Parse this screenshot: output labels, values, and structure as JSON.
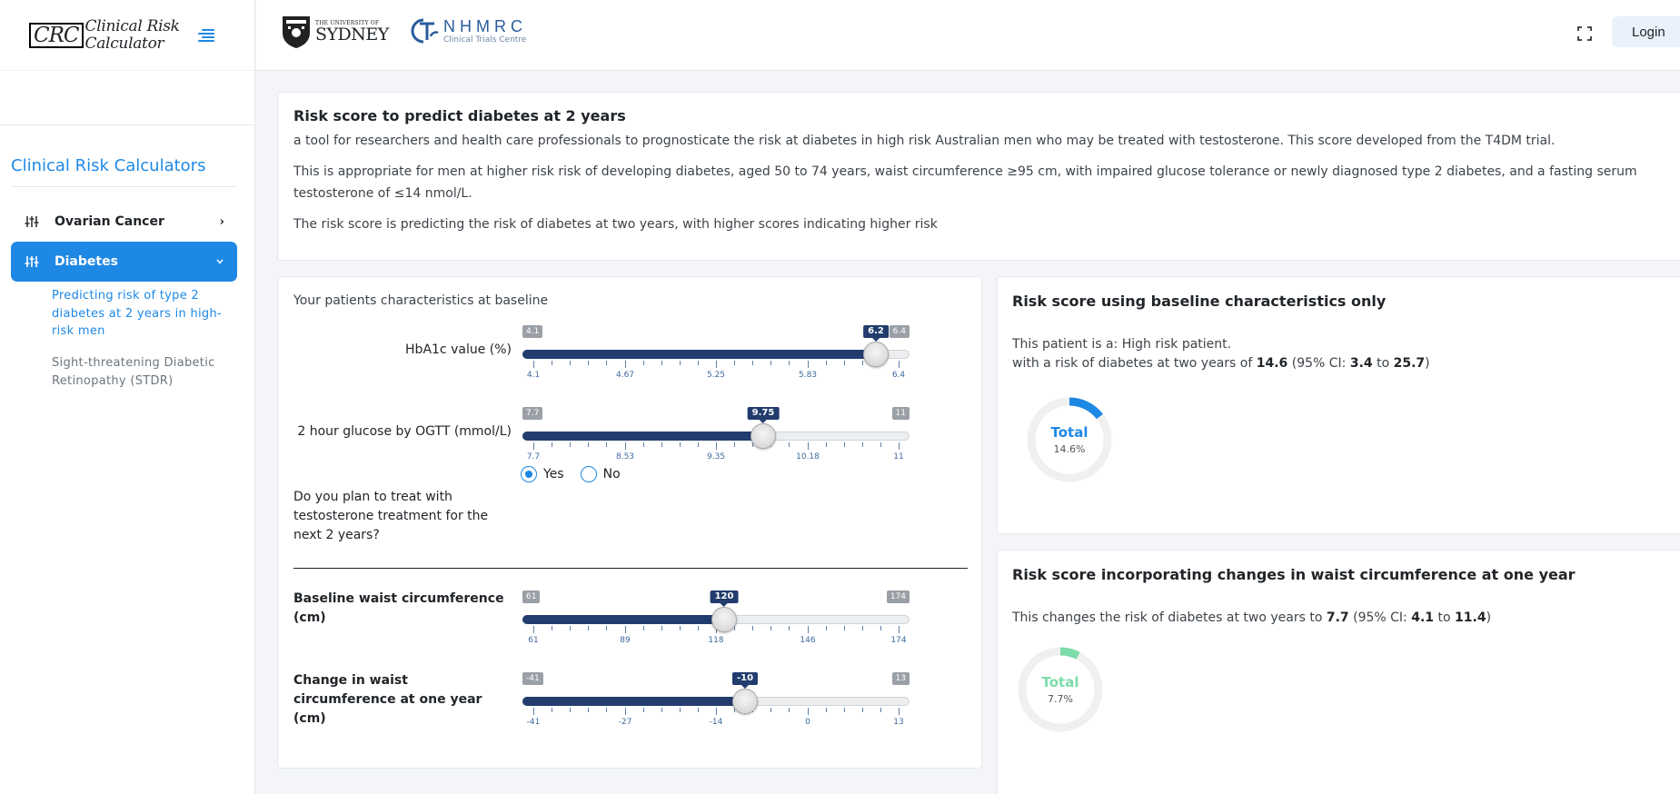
{
  "brand": {
    "crc": "CRC",
    "line1": "Clinical Risk",
    "line2": "Calculator"
  },
  "sidebar": {
    "title": "Clinical Risk Calculators",
    "items": [
      {
        "label": "Ovarian Cancer"
      },
      {
        "label": "Diabetes"
      }
    ],
    "sublinks": [
      {
        "label": "Predicting risk of type 2 diabetes at 2 years in high-risk men"
      },
      {
        "label": "Sight-threatening Diabetic Retinopathy (STDR)"
      }
    ]
  },
  "topbar": {
    "sydney_small": "THE UNIVERSITY OF",
    "sydney_big": "SYDNEY",
    "nhmrc_big": "NHMRC",
    "nhmrc_small": "Clinical Trials Centre",
    "login_label": "Login"
  },
  "info": {
    "title": "Risk score to predict diabetes at 2 years",
    "p1": "a tool for researchers and health care professionals to prognosticate the risk at diabetes in high risk Australian men who may be treated with testosterone. This score developed from the T4DM trial.",
    "p2": "This is appropriate for men at higher risk risk of developing diabetes, aged 50 to 74 years, waist circumference ≥95 cm, with impaired glucose tolerance or newly diagnosed type 2 diabetes, and a fasting serum testosterone of ≤14 nmol/L.",
    "p3": "The risk score is predicting the risk of diabetes at two years, with higher scores indicating higher risk"
  },
  "inputs": {
    "heading": "Your patients characteristics at baseline",
    "hba1c": {
      "label": "HbA1c value (%)",
      "min": 4.1,
      "max": 6.4,
      "value": 6.2,
      "min_label": "4.1",
      "max_label": "6.4",
      "value_label": "6.2",
      "ticks": [
        "4.1",
        "4.67",
        "5.25",
        "5.83",
        "6.4"
      ]
    },
    "glucose": {
      "label": "2 hour glucose by OGTT (mmol/L)",
      "min": 7.7,
      "max": 11,
      "value": 9.75,
      "min_label": "7.7",
      "max_label": "11",
      "value_label": "9.75",
      "ticks": [
        "7.7",
        "8.53",
        "9.35",
        "10.18",
        "11"
      ]
    },
    "question": "Do you plan to treat with testosterone treatment for the next 2 years?",
    "yes_label": "Yes",
    "no_label": "No",
    "selected": "yes",
    "waist": {
      "label": "Baseline waist circumference (cm)",
      "min": 61,
      "max": 174,
      "value": 120,
      "min_label": "61",
      "max_label": "174",
      "value_label": "120",
      "ticks": [
        "61",
        "89",
        "118",
        "146",
        "174"
      ]
    },
    "waist_change": {
      "label": "Change in waist circumference at one year (cm)",
      "min": -41,
      "max": 13,
      "value": -10,
      "min_label": "-41",
      "max_label": "13",
      "value_label": "-10",
      "ticks": [
        "-41",
        "-27",
        "-14",
        "0",
        "13"
      ]
    }
  },
  "result1": {
    "title": "Risk score using baseline characteristics only",
    "line1": "This patient is a: High risk patient.",
    "line2_pre": "with a risk of diabetes at two years of ",
    "risk": "14.6",
    "ci_pre": " (95% CI: ",
    "ci_low": "3.4",
    "ci_mid": " to ",
    "ci_high": "25.7",
    "ci_post": ")",
    "donut_label": "Total",
    "donut_value": "14.6%",
    "donut_fraction": 0.146,
    "color": "#1e88e5"
  },
  "result2": {
    "title": "Risk score incorporating changes in waist circumference at one year",
    "line_pre": "This changes the risk of diabetes at two years to ",
    "risk": "7.7",
    "ci_pre": " (95% CI: ",
    "ci_low": "4.1",
    "ci_mid": " to ",
    "ci_high": "11.4",
    "ci_post": ")",
    "donut_label": "Total",
    "donut_value": "7.7%",
    "donut_fraction": 0.077,
    "color": "#7ddba8"
  }
}
